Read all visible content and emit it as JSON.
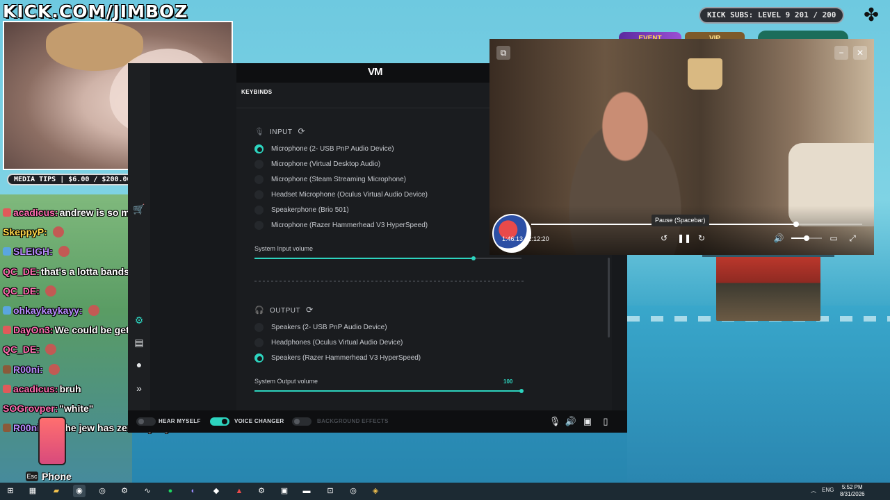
{
  "overlay": {
    "channel_banner": "KICK.COM/JIMBOZ",
    "media_tips": "MEDIA TIPS | $6.00 / $200.00",
    "kick_subs": "KICK SUBS: LEVEL 9 201 / 200",
    "event_label": "EVENT",
    "vip_label": "VIP"
  },
  "chat": [
    {
      "user": "acadicus:",
      "msg": "andrew is so much smarter than sneako",
      "color": "#ff6fb1",
      "badge": "#e05a5a"
    },
    {
      "user": "SkeppyP:",
      "msg": "",
      "color": "#ffd84a",
      "badge": "",
      "emote": true
    },
    {
      "user": "SLEIGH:",
      "msg": "",
      "color": "#b88cff",
      "badge": "#5aa6e0",
      "emote": true
    },
    {
      "user": "QC_DE:",
      "msg": "that's a lotta bands baby",
      "color": "#ff6fb1",
      "badge": ""
    },
    {
      "user": "QC_DE:",
      "msg": "",
      "color": "#ff6fb1",
      "badge": "",
      "emote": true
    },
    {
      "user": "ohkaykaykayy:",
      "msg": "",
      "color": "#b88cff",
      "badge": "#5aa6e0",
      "emote": true
    },
    {
      "user": "DayOn3:",
      "msg": "We could be getting ear raped by Claria",
      "color": "#ff6fb1",
      "badge": "#e05a5a"
    },
    {
      "user": "QC_DE:",
      "msg": "",
      "color": "#ff6fb1",
      "badge": "",
      "emote": true
    },
    {
      "user": "R00ni:",
      "msg": "",
      "color": "#b88cff",
      "badge": "#8a5a3a",
      "emote": true
    },
    {
      "user": "acadicus:",
      "msg": "bruh",
      "color": "#ff6fb1",
      "badge": "#e05a5a"
    },
    {
      "user": "SOGrovper:",
      "msg": "\"white\"",
      "color": "#ff6fb1",
      "badge": ""
    },
    {
      "user": "R00ni:",
      "msg": "ofc the jew has zero loyalty",
      "color": "#b88cff",
      "badge": "#8a5a3a"
    }
  ],
  "phone": {
    "esc_key": "Esc",
    "label": "Phone"
  },
  "voicemod": {
    "logo": "VM",
    "keybinds": "KEYBINDS",
    "input": {
      "title": "INPUT",
      "devices": [
        {
          "label": "Microphone (2- USB PnP Audio Device)",
          "selected": true
        },
        {
          "label": "Microphone (Virtual Desktop Audio)",
          "selected": false
        },
        {
          "label": "Microphone (Steam Streaming Microphone)",
          "selected": false
        },
        {
          "label": "Headset Microphone (Oculus Virtual Audio Device)",
          "selected": false
        },
        {
          "label": "Speakerphone (Brio 501)",
          "selected": false
        },
        {
          "label": "Microphone (Razer Hammerhead V3 HyperSpeed)",
          "selected": false
        }
      ],
      "volume_label": "System Input volume",
      "volume_fraction": 0.82
    },
    "output": {
      "title": "OUTPUT",
      "devices": [
        {
          "label": "Speakers (2- USB PnP Audio Device)",
          "selected": false
        },
        {
          "label": "Headphones (Oculus Virtual Audio Device)",
          "selected": false
        },
        {
          "label": "Speakers (Razer Hammerhead V3 HyperSpeed)",
          "selected": true
        }
      ],
      "volume_label": "System Output volume",
      "volume_value": "100",
      "volume_fraction": 1.0
    },
    "bottom": {
      "hear_myself": "HEAR MYSELF",
      "voice_changer": "VOICE CHANGER",
      "background_effects": "BACKGROUND EFFECTS"
    }
  },
  "player": {
    "time_current": "1:46:13",
    "time_total": "2:12:20",
    "progress_fraction": 0.8,
    "volume_fraction": 0.5,
    "tooltip": "Pause (Spacebar)"
  },
  "taskbar": {
    "lang": "ENG",
    "time": "5:52 PM",
    "date": "8/31/2026"
  },
  "colors": {
    "accent": "#2dd4bf",
    "vm_bg": "#17191c"
  }
}
